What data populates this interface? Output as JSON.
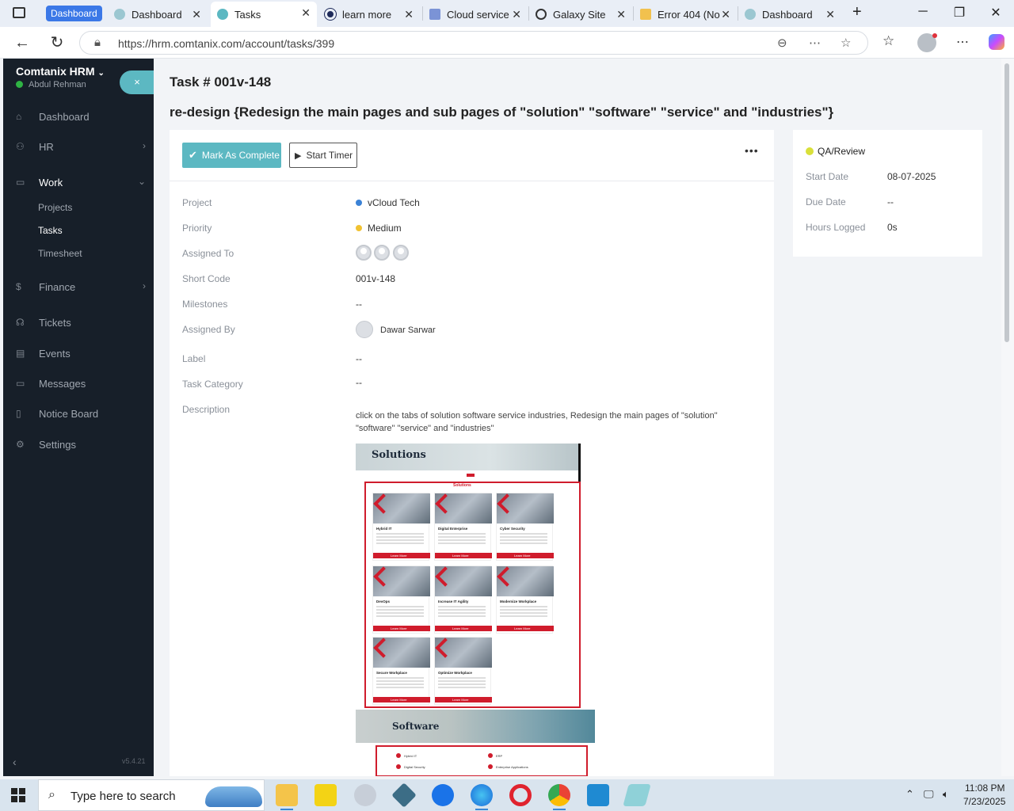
{
  "browser": {
    "group_label": "Dashboard",
    "tabs": [
      {
        "label": "Dashboard",
        "icon": "hrm-icon",
        "active": false
      },
      {
        "label": "Tasks",
        "icon": "hrm-icon",
        "active": true
      },
      {
        "label": "learn more",
        "icon": "circle-logo-icon",
        "active": false
      },
      {
        "label": "Cloud service",
        "icon": "forms-icon",
        "active": false
      },
      {
        "label": "Galaxy Site",
        "icon": "globe-icon",
        "active": false
      },
      {
        "label": "Error 404 (No",
        "icon": "w-icon",
        "active": false
      },
      {
        "label": "Dashboard",
        "icon": "hrm-icon",
        "active": false
      }
    ],
    "url": "https://hrm.comtanix.com/account/tasks/399"
  },
  "sidebar": {
    "brand": "Comtanix HRM",
    "user": "Abdul Rehman",
    "close_glyph": "×",
    "items": [
      {
        "label": "Dashboard",
        "icon": "home-icon"
      },
      {
        "label": "HR",
        "icon": "users-icon"
      },
      {
        "label": "Work",
        "icon": "briefcase-icon"
      },
      {
        "label": "Finance",
        "icon": "dollar-icon"
      },
      {
        "label": "Tickets",
        "icon": "headset-icon"
      },
      {
        "label": "Events",
        "icon": "calendar-icon"
      },
      {
        "label": "Messages",
        "icon": "chat-icon"
      },
      {
        "label": "Notice Board",
        "icon": "clipboard-icon"
      },
      {
        "label": "Settings",
        "icon": "gear-icon"
      }
    ],
    "work_sub": [
      "Projects",
      "Tasks",
      "Timesheet"
    ],
    "version": "v5.4.21"
  },
  "task": {
    "number": "Task # 001v-148",
    "title": "re-design {Redesign the main pages and sub pages of \"solution\" \"software\" \"service\" and \"industries\"}",
    "buttons": {
      "complete": "Mark As Complete",
      "timer": "Start Timer"
    },
    "fields": {
      "project_label": "Project",
      "project": "vCloud Tech",
      "priority_label": "Priority",
      "priority": "Medium",
      "assigned_to_label": "Assigned To",
      "short_code_label": "Short Code",
      "short_code": "001v-148",
      "milestones_label": "Milestones",
      "milestones": "--",
      "assigned_by_label": "Assigned By",
      "assigned_by": "Dawar Sarwar",
      "label_label": "Label",
      "label": "--",
      "category_label": "Task Category",
      "category": "--",
      "description_label": "Description",
      "description": "click on the tabs of solution software service industries, Redesign the main pages of \"solution\" \"software\" \"service\" and \"industries\""
    },
    "colors": {
      "project_dot": "#3b82d6",
      "priority_dot": "#f1c232",
      "status_dot": "#d9e03a",
      "accent": "#5cb8c2"
    }
  },
  "attachment": {
    "solutions_heading": "Solutions",
    "frame_title": "Solutions",
    "tiles": [
      "Hybrid IT",
      "Digital Enterprise",
      "Cyber Security",
      "DevOps",
      "Increase IT Agility",
      "Modernize Workplace",
      "Secure Workplace",
      "Optimize Workplace"
    ],
    "learn_more": "Learn More",
    "software_heading": "Software",
    "software_items": [
      "Hybrid IT",
      "ERP",
      "Digital Security",
      "Enterprise Applications"
    ]
  },
  "status_card": {
    "status": "QA/Review",
    "start_label": "Start Date",
    "start": "08-07-2025",
    "due_label": "Due Date",
    "due": "--",
    "hours_label": "Hours Logged",
    "hours": "0s"
  },
  "taskbar": {
    "search_placeholder": "Type here to search",
    "time": "11:08 PM",
    "date": "7/23/2025"
  }
}
